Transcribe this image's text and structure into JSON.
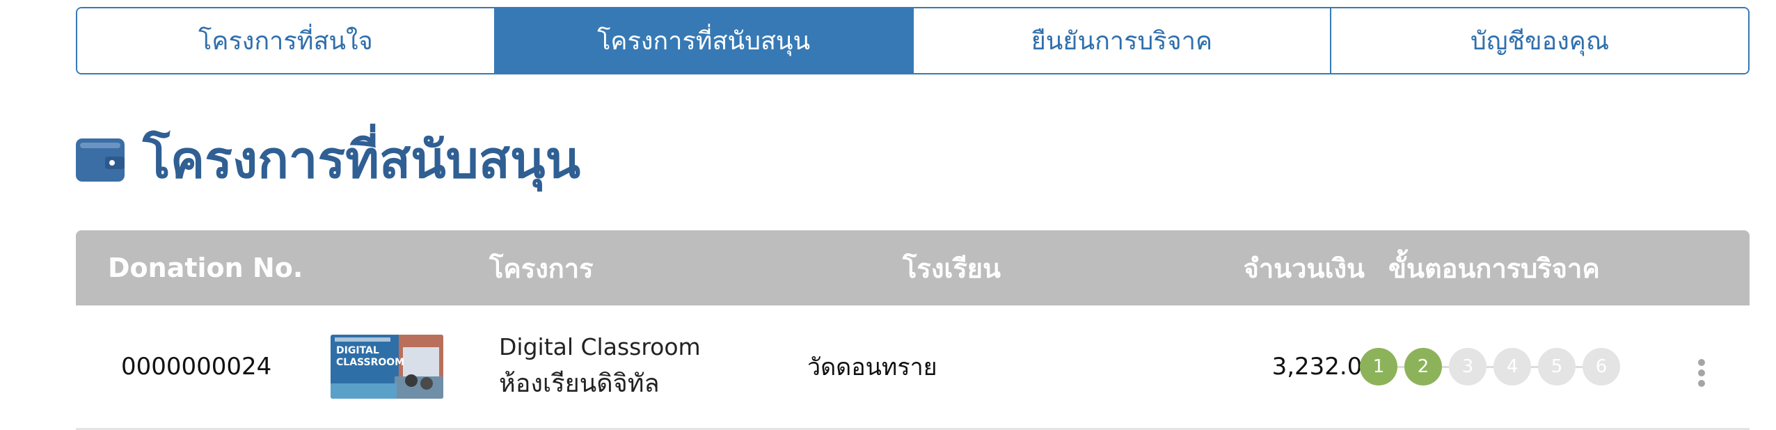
{
  "tabs": [
    {
      "label": "โครงการที่สนใจ",
      "active": false
    },
    {
      "label": "โครงการที่สนับสนุน",
      "active": true
    },
    {
      "label": "ยืนยันการบริจาค",
      "active": false
    },
    {
      "label": "บัญชีของคุณ",
      "active": false
    }
  ],
  "heading": {
    "icon": "wallet-icon",
    "title": "โครงการที่สนับสนุน"
  },
  "table": {
    "headers": {
      "donation_no": "Donation No.",
      "project": "โครงการ",
      "school": "โรงเรียน",
      "amount": "จำนวนเงิน",
      "steps": "ขั้นตอนการบริจาค"
    },
    "rows": [
      {
        "donation_no": "0000000024",
        "thumbnail_text": "DIGITAL CLASSROOM",
        "project_en": "Digital Classroom",
        "project_th": "ห้องเรียนดิจิทัล",
        "school": "วัดดอนทราย",
        "amount": "3,232.00",
        "steps": [
          {
            "label": "1",
            "done": true
          },
          {
            "label": "2",
            "done": true
          },
          {
            "label": "3",
            "done": false
          },
          {
            "label": "4",
            "done": false
          },
          {
            "label": "5",
            "done": false
          },
          {
            "label": "6",
            "done": false
          }
        ]
      }
    ]
  },
  "colors": {
    "primary": "#3679b5",
    "title": "#2f5f93",
    "header_bg": "#bdbdbd",
    "step_done": "#8cb35a",
    "step_pending": "#e4e4e4"
  }
}
